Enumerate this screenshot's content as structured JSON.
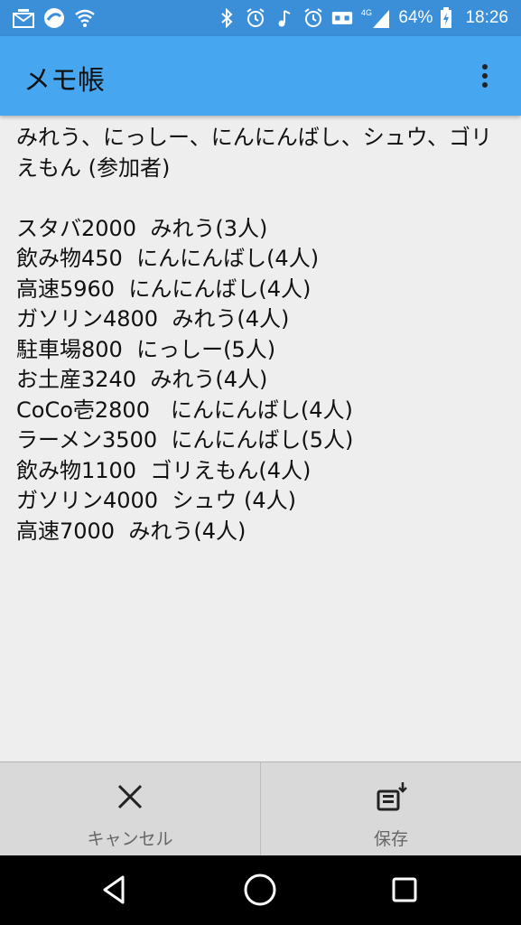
{
  "status_bar": {
    "battery_percent": "64%",
    "network": "4G",
    "time": "18:26"
  },
  "app_bar": {
    "title": "メモ帳"
  },
  "editor": {
    "text": "みれう、にっしー、にんにんばし、シュウ、ゴリえもん (参加者)\n\nスタバ2000  みれう(3人)\n飲み物450  にんにんばし(4人)\n高速5960  にんにんばし(4人)\nガソリン4800  みれう(4人)\n駐車場800  にっしー(5人)\nお土産3240  みれう(4人)\nCoCo壱2800   にんにんばし(4人)\nラーメン3500  にんにんばし(5人)\n飲み物1100  ゴリえもん(4人)\nガソリン4000  シュウ (4人)\n高速7000  みれう(4人)"
  },
  "buttons": {
    "cancel": {
      "label": "キャンセル",
      "icon": "close-icon"
    },
    "save": {
      "label": "保存",
      "icon": "save-to-sd-icon"
    }
  },
  "colors": {
    "status_bar": "#3b8fd8",
    "app_bar": "#47a6f0",
    "background": "#eeeeee",
    "button_bar": "#d9d9d9",
    "nav_bar": "#000000"
  }
}
